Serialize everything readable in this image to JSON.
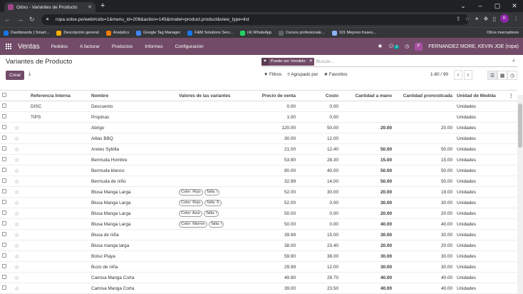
{
  "browser": {
    "tab_title": "Odoo - Variantes de Producto",
    "url": "ropa.solse.pe/web#cids=1&menu_id=206&action=145&model=product.product&view_type=list",
    "avatar": "K",
    "bookmarks": [
      {
        "label": "Dashboards | Smart...",
        "color": "#1a73e8"
      },
      {
        "label": "Descripción general",
        "color": "#f9ab00"
      },
      {
        "label": "Analytics",
        "color": "#f57c00"
      },
      {
        "label": "Google Tag Manager",
        "color": "#4285f4"
      },
      {
        "label": "F&M Solutions Serv...",
        "color": "#1877f2"
      },
      {
        "label": "(4) WhatsApp",
        "color": "#25d366"
      },
      {
        "label": "Cursos profesionale...",
        "color": "#5f6368"
      },
      {
        "label": "101 Mejores frases...",
        "color": "#8ab4f8"
      }
    ],
    "other_bookmarks": "Otros marcadores"
  },
  "nav": {
    "app": "Ventas",
    "menus": [
      "Pedidos",
      "A facturar",
      "Productos",
      "Informes",
      "Configuración"
    ],
    "badge": "2",
    "user": "FERNANDEZ MORE, KEVIN JOE (ropa)",
    "user_initial": "F"
  },
  "page": {
    "title": "Variantes de Producto",
    "facet": "Puede ser Vendido",
    "search_placeholder": "Buscar...",
    "create": "Crear",
    "filters": "Filtros",
    "group_by": "Agrupado por",
    "favorites": "Favoritos",
    "pager": "1-80 / 99"
  },
  "columns": [
    "Referencia Interna",
    "Nombre",
    "Valores de las variantes",
    "Precio de venta",
    "Costo",
    "Cantidad a mano",
    "Cantidad pronosticada",
    "Unidad de Medida"
  ],
  "rows": [
    {
      "star": false,
      "ref": "DISC",
      "name": "Descuento",
      "tags": [],
      "price": "0.00",
      "cost": "0.00",
      "onhand": "",
      "forecast": "",
      "uom": "Unidades"
    },
    {
      "star": false,
      "ref": "TIPS",
      "name": "Propinas",
      "tags": [],
      "price": "1.00",
      "cost": "0.00",
      "onhand": "",
      "forecast": "",
      "uom": "Unidades"
    },
    {
      "star": true,
      "ref": "",
      "name": "Abrigo",
      "tags": [],
      "price": "120.00",
      "cost": "50.00",
      "onhand": "20.00",
      "forecast": "20.00",
      "uom": "Unidades"
    },
    {
      "star": true,
      "ref": "",
      "name": "Alitas BBQ",
      "tags": [],
      "price": "30.00",
      "cost": "12.00",
      "onhand": "",
      "forecast": "",
      "uom": "Unidades"
    },
    {
      "star": true,
      "ref": "",
      "name": "Aretes Sybilla",
      "tags": [],
      "price": "21.00",
      "cost": "12.40",
      "onhand": "50.00",
      "forecast": "50.00",
      "uom": "Unidades"
    },
    {
      "star": true,
      "ref": "",
      "name": "Bermuda Hombre",
      "tags": [],
      "price": "53.90",
      "cost": "28.30",
      "onhand": "15.00",
      "forecast": "15.00",
      "uom": "Unidades"
    },
    {
      "star": true,
      "ref": "",
      "name": "Bermuda blanco",
      "tags": [],
      "price": "90.00",
      "cost": "40.00",
      "onhand": "50.00",
      "forecast": "50.00",
      "uom": "Unidades"
    },
    {
      "star": true,
      "ref": "",
      "name": "Bermuda de niño",
      "tags": [],
      "price": "32.99",
      "cost": "14.00",
      "onhand": "50.00",
      "forecast": "50.00",
      "uom": "Unidades"
    },
    {
      "star": true,
      "ref": "",
      "name": "Blusa Manga Larga",
      "tags": [
        "Color: Rojo",
        "Talla: l"
      ],
      "price": "52.00",
      "cost": "30.00",
      "onhand": "20.00",
      "forecast": "19.00",
      "uom": "Unidades"
    },
    {
      "star": true,
      "ref": "",
      "name": "Blusa Manga Larga",
      "tags": [
        "Color: Rojo",
        "Talla: S"
      ],
      "price": "52.00",
      "cost": "0.00",
      "onhand": "30.00",
      "forecast": "30.00",
      "uom": "Unidades"
    },
    {
      "star": true,
      "ref": "",
      "name": "Blusa Manga Larga",
      "tags": [
        "Color: Azul",
        "Talla: l"
      ],
      "price": "50.00",
      "cost": "0.00",
      "onhand": "20.00",
      "forecast": "20.00",
      "uom": "Unidades"
    },
    {
      "star": true,
      "ref": "",
      "name": "Blusa Manga Larga",
      "tags": [
        "Color: Marron",
        "Talla: l"
      ],
      "price": "50.00",
      "cost": "0.00",
      "onhand": "40.00",
      "forecast": "40.00",
      "uom": "Unidades"
    },
    {
      "star": true,
      "ref": "",
      "name": "Blusa de niña",
      "tags": [],
      "price": "39.99",
      "cost": "15.00",
      "onhand": "30.00",
      "forecast": "30.00",
      "uom": "Unidades"
    },
    {
      "star": true,
      "ref": "",
      "name": "Blusa manga larga",
      "tags": [],
      "price": "38.00",
      "cost": "23.40",
      "onhand": "20.00",
      "forecast": "20.00",
      "uom": "Unidades"
    },
    {
      "star": true,
      "ref": "",
      "name": "Bolso Playa",
      "tags": [],
      "price": "59.90",
      "cost": "38.00",
      "onhand": "30.00",
      "forecast": "30.00",
      "uom": "Unidades"
    },
    {
      "star": true,
      "ref": "",
      "name": "Buzo de niña",
      "tags": [],
      "price": "29.99",
      "cost": "12.00",
      "onhand": "30.00",
      "forecast": "30.00",
      "uom": "Unidades"
    },
    {
      "star": true,
      "ref": "",
      "name": "Camisa Manga Corta",
      "tags": [],
      "price": "49.90",
      "cost": "29.70",
      "onhand": "40.00",
      "forecast": "40.00",
      "uom": "Unidades"
    },
    {
      "star": true,
      "ref": "",
      "name": "Camisa Manga Corta",
      "tags": [],
      "price": "39.00",
      "cost": "23.50",
      "onhand": "40.00",
      "forecast": "40.00",
      "uom": "Unidades"
    }
  ]
}
